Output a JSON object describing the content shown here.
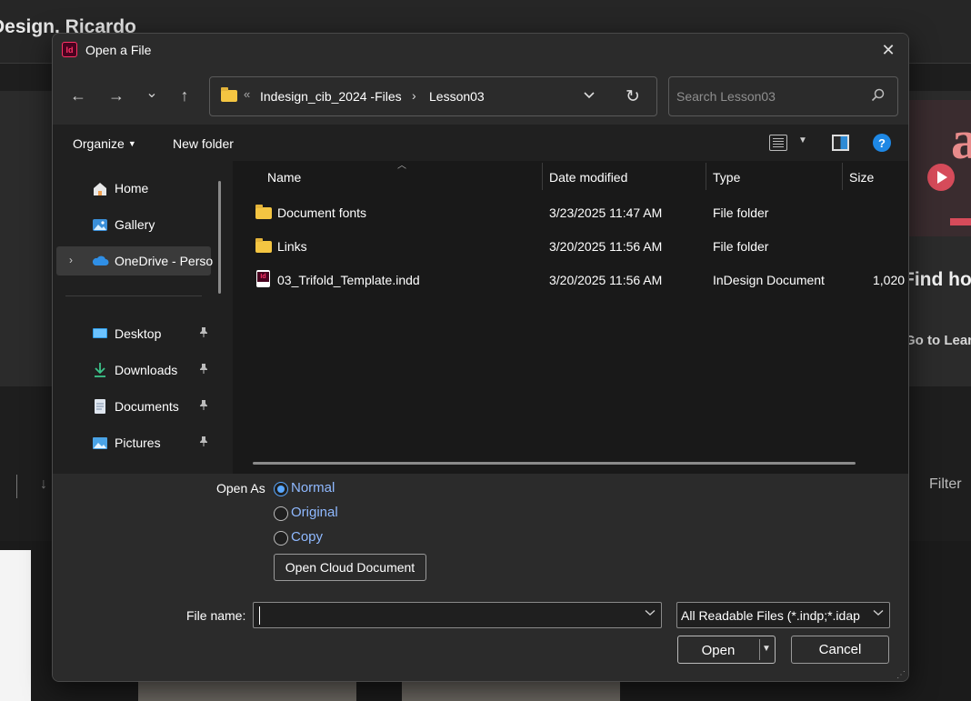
{
  "background": {
    "title": "Design, Ricardo",
    "find_text": "Find how",
    "goto_text": "Go to Lear",
    "filter_label": "Filter"
  },
  "dialog": {
    "title": "Open a File",
    "close_glyph": "✕",
    "nav": {
      "back_glyph": "←",
      "forward_glyph": "→",
      "recent_glyph": "⌄",
      "up_glyph": "↑"
    },
    "address": {
      "overflow": "«",
      "segments": [
        "Indesign_cib_2024 -Files",
        "Lesson03"
      ],
      "separator": "›",
      "chevron": "⌄",
      "refresh_glyph": "↻"
    },
    "search": {
      "placeholder": "Search Lesson03",
      "icon_glyph": "⚲"
    },
    "toolbar": {
      "organize_label": "Organize",
      "new_folder_label": "New folder",
      "help_label": "?"
    },
    "nav_pane": {
      "items": [
        {
          "label": "Home",
          "icon": "home-icon",
          "glyph": "🏠"
        },
        {
          "label": "Gallery",
          "icon": "gallery-icon",
          "glyph": "🖼"
        },
        {
          "label": "OneDrive - Perso",
          "icon": "onedrive-icon",
          "glyph": "☁"
        },
        {
          "label": "Desktop",
          "icon": "desktop-icon",
          "glyph": "▭"
        },
        {
          "label": "Downloads",
          "icon": "downloads-icon",
          "glyph": "⤓"
        },
        {
          "label": "Documents",
          "icon": "documents-icon",
          "glyph": "▤"
        },
        {
          "label": "Pictures",
          "icon": "pictures-icon",
          "glyph": "▨"
        }
      ],
      "pin_glyph": "📌",
      "expand_glyph": "›"
    },
    "columns": {
      "name": "Name",
      "date": "Date modified",
      "type": "Type",
      "size": "Size"
    },
    "files": [
      {
        "name": "Document fonts",
        "date": "3/23/2025 11:47 AM",
        "type": "File folder",
        "size": "",
        "kind": "folder"
      },
      {
        "name": "Links",
        "date": "3/20/2025 11:56 AM",
        "type": "File folder",
        "size": "",
        "kind": "folder"
      },
      {
        "name": "03_Trifold_Template.indd",
        "date": "3/20/2025 11:56 AM",
        "type": "InDesign Document",
        "size": "1,020",
        "kind": "indd"
      }
    ],
    "open_as": {
      "label": "Open As",
      "options": [
        "Normal",
        "Original",
        "Copy"
      ],
      "selected": "Normal"
    },
    "cloud_button": "Open Cloud Document",
    "file_name": {
      "label": "File name:",
      "value": ""
    },
    "file_type": "All Readable Files (*.indp;*.idap",
    "open_label": "Open",
    "cancel_label": "Cancel",
    "accent_color": "#5aa8ff"
  }
}
